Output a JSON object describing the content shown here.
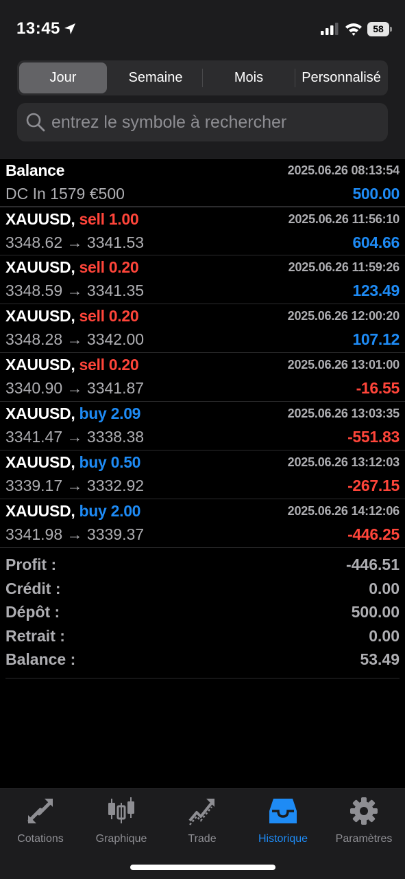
{
  "status_bar": {
    "time": "13:45",
    "battery": "58"
  },
  "period_tabs": [
    "Jour",
    "Semaine",
    "Mois",
    "Personnalisé"
  ],
  "selected_period": "Jour",
  "search": {
    "placeholder": "entrez le symbole à rechercher",
    "value": ""
  },
  "balance_entry": {
    "title": "Balance",
    "date": "2025.06.26 08:13:54",
    "description": "DC In 1579 €500",
    "amount": "500.00"
  },
  "trades": [
    {
      "symbol": "XAUUSD,",
      "side": "sell",
      "volume": "1.00",
      "date": "2025.06.26 11:56:10",
      "open": "3348.62",
      "close": "3341.53",
      "profit": "604.66"
    },
    {
      "symbol": "XAUUSD,",
      "side": "sell",
      "volume": "0.20",
      "date": "2025.06.26 11:59:26",
      "open": "3348.59",
      "close": "3341.35",
      "profit": "123.49"
    },
    {
      "symbol": "XAUUSD,",
      "side": "sell",
      "volume": "0.20",
      "date": "2025.06.26 12:00:20",
      "open": "3348.28",
      "close": "3342.00",
      "profit": "107.12"
    },
    {
      "symbol": "XAUUSD,",
      "side": "sell",
      "volume": "0.20",
      "date": "2025.06.26 13:01:00",
      "open": "3340.90",
      "close": "3341.87",
      "profit": "-16.55"
    },
    {
      "symbol": "XAUUSD,",
      "side": "buy",
      "volume": "2.09",
      "date": "2025.06.26 13:03:35",
      "open": "3341.47",
      "close": "3338.38",
      "profit": "-551.83"
    },
    {
      "symbol": "XAUUSD,",
      "side": "buy",
      "volume": "0.50",
      "date": "2025.06.26 13:12:03",
      "open": "3339.17",
      "close": "3332.92",
      "profit": "-267.15"
    },
    {
      "symbol": "XAUUSD,",
      "side": "buy",
      "volume": "2.00",
      "date": "2025.06.26 14:12:06",
      "open": "3341.98",
      "close": "3339.37",
      "profit": "-446.25"
    }
  ],
  "arrow": "→",
  "summary": [
    {
      "label": "Profit :",
      "value": "-446.51"
    },
    {
      "label": "Crédit :",
      "value": "0.00"
    },
    {
      "label": "Dépôt :",
      "value": "500.00"
    },
    {
      "label": "Retrait :",
      "value": "0.00"
    },
    {
      "label": "Balance :",
      "value": "53.49"
    }
  ],
  "tab_bar": [
    {
      "label": "Cotations",
      "icon": "quotes-arrows-icon",
      "active": false
    },
    {
      "label": "Graphique",
      "icon": "candlestick-chart-icon",
      "active": false
    },
    {
      "label": "Trade",
      "icon": "trade-trend-icon",
      "active": false
    },
    {
      "label": "Historique",
      "icon": "history-inbox-icon",
      "active": true
    },
    {
      "label": "Paramètres",
      "icon": "gear-icon",
      "active": false
    }
  ],
  "colors": {
    "accent": "#1e8bf5",
    "negative": "#ff453a",
    "background": "#000000",
    "panel": "#1c1c1e"
  }
}
